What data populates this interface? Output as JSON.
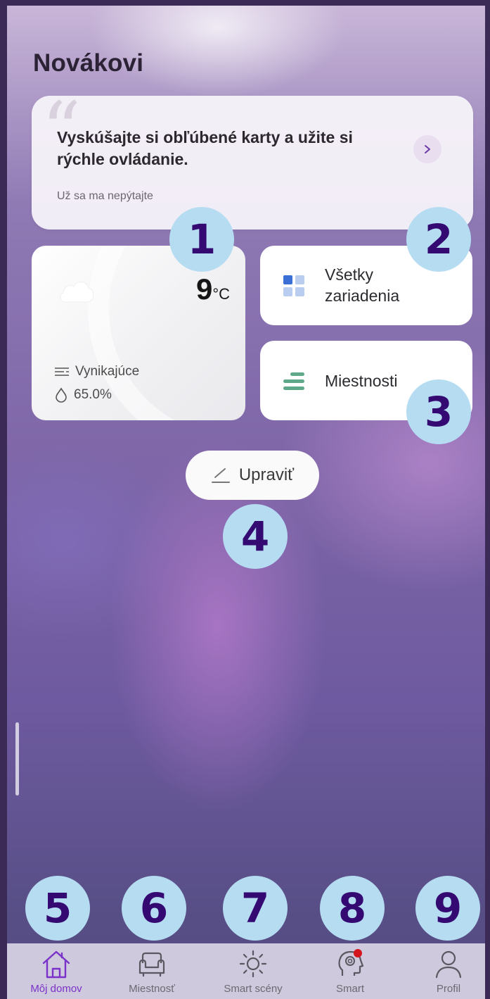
{
  "header": {
    "title": "Novákovi"
  },
  "tip_card": {
    "text": "Vyskúšajte si obľúbené karty a užite si rýchle ovládanie.",
    "dismiss": "Už sa ma nepýtajte",
    "icon": "chevron-right-icon"
  },
  "weather": {
    "icon": "cloud-icon",
    "temperature": "9",
    "unit": "°C",
    "air_quality": "Vynikajúce",
    "humidity": "65.0%"
  },
  "tiles": {
    "all_devices": {
      "label": "Všetky zariadenia",
      "icon": "grid-icon"
    },
    "rooms": {
      "label": "Miestnosti",
      "icon": "rooms-icon"
    }
  },
  "edit": {
    "label": "Upraviť",
    "icon": "pencil-icon"
  },
  "callouts": [
    "1",
    "2",
    "3",
    "4",
    "5",
    "6",
    "7",
    "8",
    "9"
  ],
  "nav": {
    "active_color": "#7a32c8",
    "items": [
      {
        "label": "Môj domov",
        "icon": "home-icon",
        "active": true
      },
      {
        "label": "Miestnosť",
        "icon": "armchair-icon"
      },
      {
        "label": "Smart scény",
        "icon": "sun-icon"
      },
      {
        "label": "Smart",
        "icon": "brain-icon",
        "badge_color": "#d4161c"
      },
      {
        "label": "Profil",
        "icon": "user-icon"
      }
    ]
  },
  "colors": {
    "callout_bg": "#b6dcf2",
    "callout_text": "#340a72",
    "grid_accent": "#3b6fd6"
  }
}
